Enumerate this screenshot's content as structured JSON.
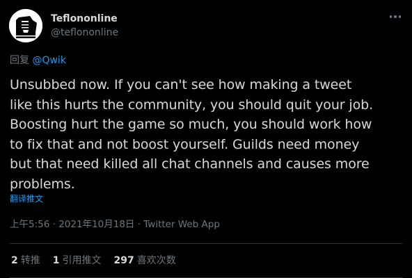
{
  "user": {
    "display_name": "Teflononline",
    "handle": "@teflononline",
    "avatar_icon": "sphinx-icon"
  },
  "reply": {
    "prefix": "回复",
    "mention": "@Qwik"
  },
  "tweet": {
    "lines": [
      "Unsubbed now. If you can't see how making a tweet",
      "like this hurts the community, you should quit your job.",
      "Boosting hurt the game so much, you should work how",
      "to fix that and not boost yourself. Guilds need money",
      "but that need killed all chat channels and causes more",
      "problems."
    ],
    "translate_label": "翻译推文",
    "meta": "上午5:56 · 2021年10月18日 · Twitter Web App"
  },
  "stats": {
    "retweets_count": "2",
    "retweets_label": "转推",
    "quotes_count": "1",
    "quotes_label": "引用推文",
    "likes_count": "297",
    "likes_label": "喜欢次数"
  },
  "colors": {
    "background": "#000000",
    "text": "#d9d9d9",
    "secondary": "#6e767d",
    "accent": "#1d9bf0",
    "divider": "#2f3336"
  }
}
